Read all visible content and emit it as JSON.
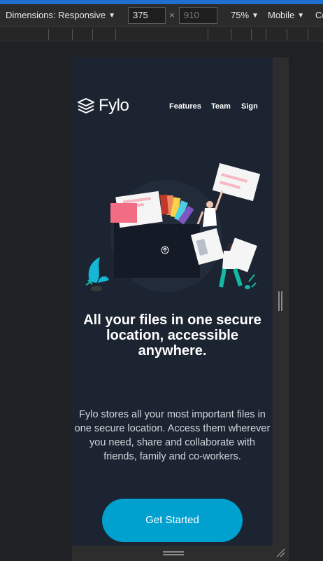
{
  "devtools": {
    "dimensions_label": "Dimensions: Responsive",
    "width_value": "375",
    "height_value": "910",
    "times_symbol": "×",
    "zoom": "75%",
    "device_mode": "Mobile",
    "overflow_text": "C("
  },
  "page": {
    "brand": "Fylo",
    "nav": [
      "Features",
      "Team",
      "Sign"
    ],
    "headline": "All your files in one secure location, accessible anywhere.",
    "subtext": "Fylo stores all your most important files in one secure location. Access them wherever you need, share and collaborate with friends, family and co-workers.",
    "cta_label": "Get Started",
    "colors": {
      "background": "#1c2431",
      "accent": "#00a0cf",
      "text": "#ffffff"
    }
  }
}
